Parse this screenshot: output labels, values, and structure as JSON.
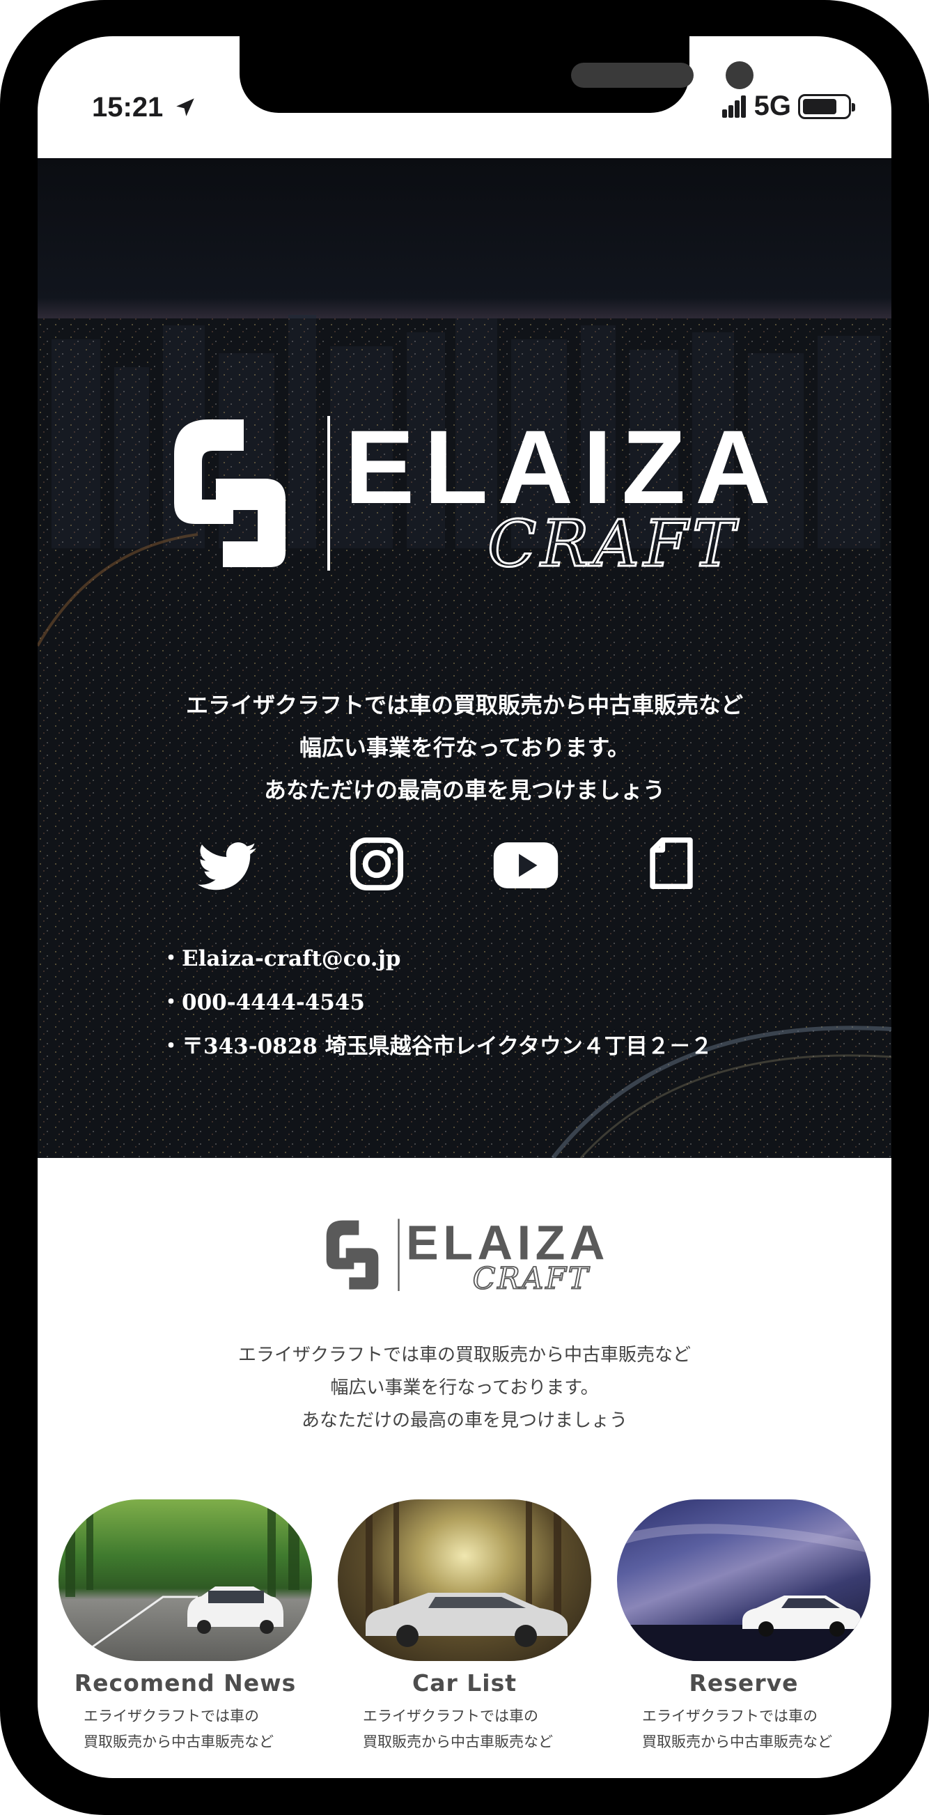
{
  "status_bar": {
    "time": "15:21",
    "network": "5G"
  },
  "brand": {
    "name": "ELAIZA",
    "sub": "CRAFT"
  },
  "hero": {
    "lines": [
      "エライザクラフトでは車の買取販売から中古車販売など",
      "幅広い事業を行なっております。",
      "あなただけの最高の車を見つけましょう"
    ],
    "social_icons": [
      "twitter-icon",
      "instagram-icon",
      "youtube-icon",
      "note-icon"
    ],
    "contacts": [
      "・Elaiza-craft@co.jp",
      "・000-4444-4545",
      "・〒343-0828 埼玉県越谷市レイクタウン４丁目２－２"
    ]
  },
  "about": {
    "lines": [
      "エライザクラフトでは車の買取販売から中古車販売など",
      "幅広い事業を行なっております。",
      "あなただけの最高の車を見つけましょう"
    ]
  },
  "cards": [
    {
      "title": "Recomend News",
      "desc1": "エライザクラフトでは車の",
      "desc2": "買取販売から中古車販売など"
    },
    {
      "title": "Car List",
      "desc1": "エライザクラフトでは車の",
      "desc2": "買取販売から中古車販売など"
    },
    {
      "title": "Reserve",
      "desc1": "エライザクラフトでは車の",
      "desc2": "買取販売から中古車販売など"
    }
  ],
  "colors": {
    "frame": "#000000",
    "hero_bg": "#15181e",
    "text_light": "#ffffff",
    "text_gray": "#4d4d4d"
  }
}
